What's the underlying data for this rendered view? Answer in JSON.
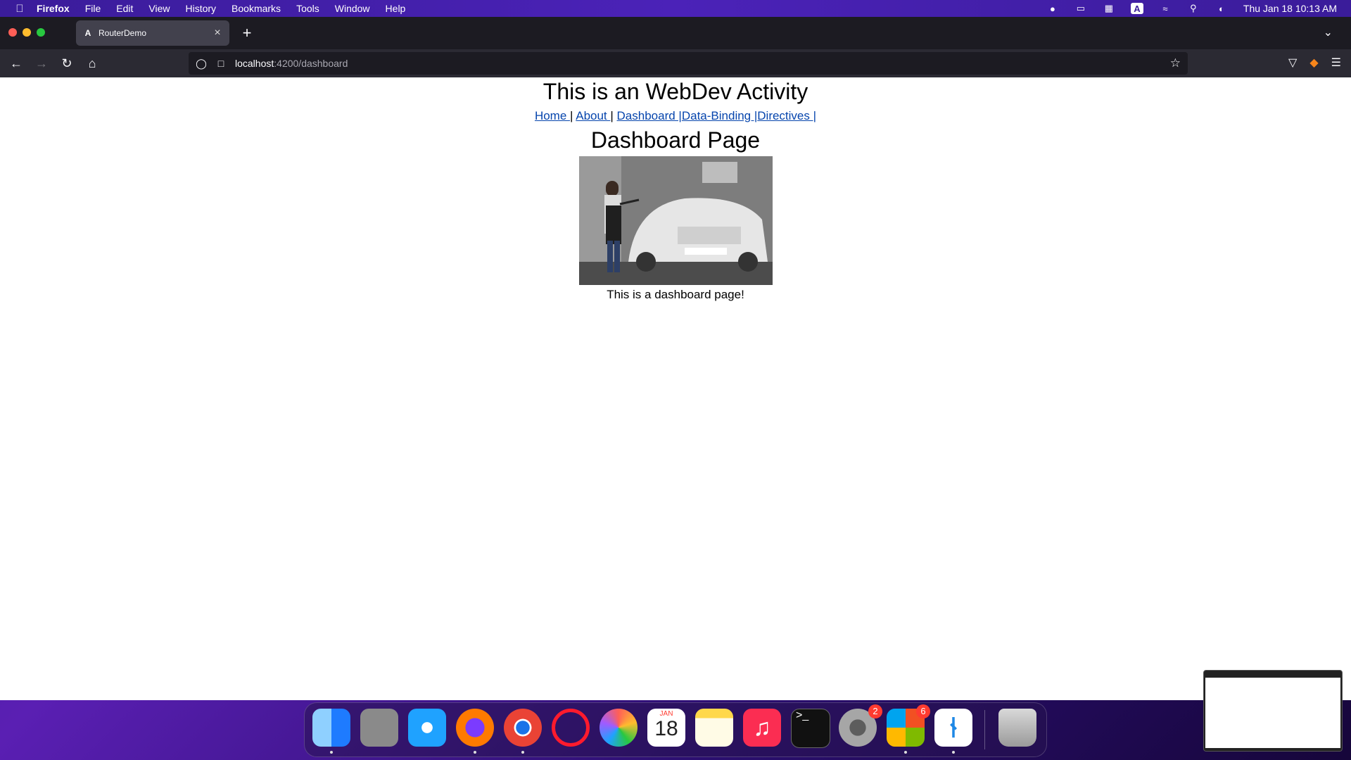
{
  "menubar": {
    "app": "Firefox",
    "items": [
      "File",
      "Edit",
      "View",
      "History",
      "Bookmarks",
      "Tools",
      "Window",
      "Help"
    ],
    "datetime": "Thu Jan 18  10:13 AM"
  },
  "browser": {
    "tab_title": "RouterDemo",
    "url_host": "localhost",
    "url_path": ":4200/dashboard"
  },
  "page": {
    "heading": "This is an WebDev Activity",
    "nav": [
      {
        "label": "Home "
      },
      {
        "sep": "| "
      },
      {
        "label": "About "
      },
      {
        "sep": "| "
      },
      {
        "label": "Dashboard |"
      },
      {
        "label": "Data-Binding |"
      },
      {
        "label": "Directives |"
      }
    ],
    "subheading": "Dashboard Page",
    "image_desc": "man washing foamy white car",
    "text": "This is a dashboard page!"
  },
  "dock": {
    "apps": [
      {
        "name": "finder",
        "color": "#1e8bff"
      },
      {
        "name": "launchpad",
        "color": "#8a8a8a"
      },
      {
        "name": "safari",
        "color": "#1fa2ff"
      },
      {
        "name": "firefox",
        "color": "#ff7a00"
      },
      {
        "name": "chrome",
        "color": "#f3f3f3"
      },
      {
        "name": "opera",
        "color": "#ffffff"
      },
      {
        "name": "photos",
        "color": "#ffffff"
      },
      {
        "name": "calendar",
        "color": "#ffffff"
      },
      {
        "name": "notes",
        "color": "#ffd84a"
      },
      {
        "name": "music",
        "color": "#fb2d52"
      },
      {
        "name": "terminal",
        "color": "#111111"
      },
      {
        "name": "system-settings",
        "color": "#8b8b8b"
      },
      {
        "name": "app-store",
        "color": "#ffffff"
      },
      {
        "name": "vscode",
        "color": "#ffffff"
      },
      {
        "name": "trash",
        "color": "#bfbfbf"
      }
    ],
    "calendar_month": "JAN",
    "calendar_day": "18",
    "badge_settings": "2",
    "badge_appstore": "6"
  }
}
